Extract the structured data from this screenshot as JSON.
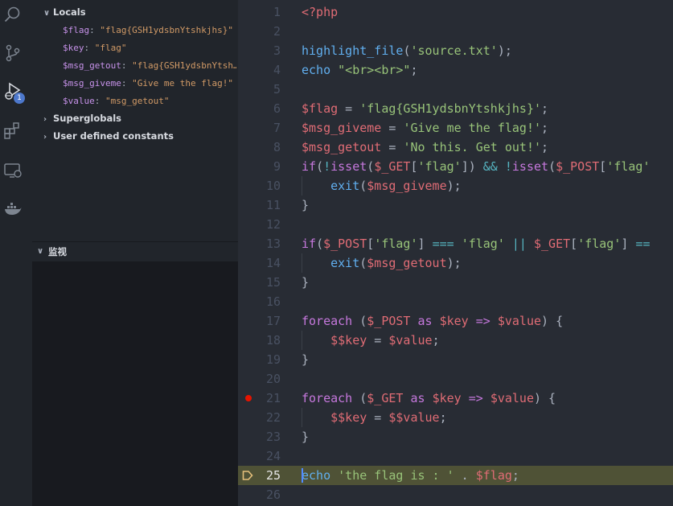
{
  "activity_bar": {
    "icons": [
      "search-icon",
      "source-control-icon",
      "run-debug-icon",
      "extensions-icon",
      "remote-explorer-icon",
      "docker-icon"
    ],
    "debug_badge": "1"
  },
  "variables": {
    "locals_label": "Locals",
    "locals": [
      {
        "name": "$flag",
        "value": "\"flag{GSH1ydsbnYtshkjhs}\""
      },
      {
        "name": "$key",
        "value": "\"flag\""
      },
      {
        "name": "$msg_getout",
        "value": "\"flag{GSH1ydsbnYtsh…"
      },
      {
        "name": "$msg_giveme",
        "value": "\"Give me the flag!\""
      },
      {
        "name": "$value",
        "value": "\"msg_getout\""
      }
    ],
    "superglobals_label": "Superglobals",
    "constants_label": "User defined constants"
  },
  "watch": {
    "label": "监视"
  },
  "editor": {
    "current_line": 25,
    "breakpoint_line": 21,
    "line_numbers": [
      "1",
      "2",
      "3",
      "4",
      "5",
      "6",
      "7",
      "8",
      "9",
      "10",
      "11",
      "12",
      "13",
      "14",
      "15",
      "16",
      "17",
      "18",
      "19",
      "20",
      "21",
      "22",
      "23",
      "24",
      "25",
      "26"
    ],
    "lines": [
      [
        {
          "t": "<?php",
          "c": "tag"
        }
      ],
      [],
      [
        {
          "t": "highlight_file",
          "c": "fn"
        },
        {
          "t": "(",
          "c": "pl"
        },
        {
          "t": "'source.txt'",
          "c": "str"
        },
        {
          "t": ");",
          "c": "pl"
        }
      ],
      [
        {
          "t": "echo",
          "c": "fn"
        },
        {
          "t": " ",
          "c": "pl"
        },
        {
          "t": "\"<br><br>\"",
          "c": "str"
        },
        {
          "t": ";",
          "c": "pl"
        }
      ],
      [],
      [
        {
          "t": "$flag",
          "c": "var"
        },
        {
          "t": " = ",
          "c": "pl"
        },
        {
          "t": "'flag{GSH1ydsbnYtshkjhs}'",
          "c": "str"
        },
        {
          "t": ";",
          "c": "pl"
        }
      ],
      [
        {
          "t": "$msg_giveme",
          "c": "var"
        },
        {
          "t": " = ",
          "c": "pl"
        },
        {
          "t": "'Give me the flag!'",
          "c": "str"
        },
        {
          "t": ";",
          "c": "pl"
        }
      ],
      [
        {
          "t": "$msg_getout",
          "c": "var"
        },
        {
          "t": " = ",
          "c": "pl"
        },
        {
          "t": "'No this. Get out!'",
          "c": "str"
        },
        {
          "t": ";",
          "c": "pl"
        }
      ],
      [
        {
          "t": "if",
          "c": "kw"
        },
        {
          "t": "(",
          "c": "pl"
        },
        {
          "t": "!",
          "c": "op"
        },
        {
          "t": "isset",
          "c": "kw"
        },
        {
          "t": "(",
          "c": "pl"
        },
        {
          "t": "$_GET",
          "c": "var"
        },
        {
          "t": "[",
          "c": "pl"
        },
        {
          "t": "'flag'",
          "c": "str"
        },
        {
          "t": "]) ",
          "c": "pl"
        },
        {
          "t": "&&",
          "c": "op"
        },
        {
          "t": " ",
          "c": "pl"
        },
        {
          "t": "!",
          "c": "op"
        },
        {
          "t": "isset",
          "c": "kw"
        },
        {
          "t": "(",
          "c": "pl"
        },
        {
          "t": "$_POST",
          "c": "var"
        },
        {
          "t": "[",
          "c": "pl"
        },
        {
          "t": "'flag'",
          "c": "str"
        }
      ],
      [
        {
          "t": "    ",
          "c": "pl"
        },
        {
          "t": "exit",
          "c": "fn"
        },
        {
          "t": "(",
          "c": "pl"
        },
        {
          "t": "$msg_giveme",
          "c": "var"
        },
        {
          "t": ");",
          "c": "pl"
        }
      ],
      [
        {
          "t": "}",
          "c": "pl"
        }
      ],
      [],
      [
        {
          "t": "if",
          "c": "kw"
        },
        {
          "t": "(",
          "c": "pl"
        },
        {
          "t": "$_POST",
          "c": "var"
        },
        {
          "t": "[",
          "c": "pl"
        },
        {
          "t": "'flag'",
          "c": "str"
        },
        {
          "t": "] ",
          "c": "pl"
        },
        {
          "t": "===",
          "c": "op"
        },
        {
          "t": " ",
          "c": "pl"
        },
        {
          "t": "'flag'",
          "c": "str"
        },
        {
          "t": " ",
          "c": "pl"
        },
        {
          "t": "||",
          "c": "op"
        },
        {
          "t": " ",
          "c": "pl"
        },
        {
          "t": "$_GET",
          "c": "var"
        },
        {
          "t": "[",
          "c": "pl"
        },
        {
          "t": "'flag'",
          "c": "str"
        },
        {
          "t": "] ",
          "c": "pl"
        },
        {
          "t": "==",
          "c": "op"
        }
      ],
      [
        {
          "t": "    ",
          "c": "pl"
        },
        {
          "t": "exit",
          "c": "fn"
        },
        {
          "t": "(",
          "c": "pl"
        },
        {
          "t": "$msg_getout",
          "c": "var"
        },
        {
          "t": ");",
          "c": "pl"
        }
      ],
      [
        {
          "t": "}",
          "c": "pl"
        }
      ],
      [],
      [
        {
          "t": "foreach",
          "c": "kw"
        },
        {
          "t": " (",
          "c": "pl"
        },
        {
          "t": "$_POST",
          "c": "var"
        },
        {
          "t": " ",
          "c": "pl"
        },
        {
          "t": "as",
          "c": "kw"
        },
        {
          "t": " ",
          "c": "pl"
        },
        {
          "t": "$key",
          "c": "var"
        },
        {
          "t": " ",
          "c": "pl"
        },
        {
          "t": "=>",
          "c": "kw"
        },
        {
          "t": " ",
          "c": "pl"
        },
        {
          "t": "$value",
          "c": "var"
        },
        {
          "t": ") {",
          "c": "pl"
        }
      ],
      [
        {
          "t": "    ",
          "c": "pl"
        },
        {
          "t": "$$key",
          "c": "var"
        },
        {
          "t": " = ",
          "c": "pl"
        },
        {
          "t": "$value",
          "c": "var"
        },
        {
          "t": ";",
          "c": "pl"
        }
      ],
      [
        {
          "t": "}",
          "c": "pl"
        }
      ],
      [],
      [
        {
          "t": "foreach",
          "c": "kw"
        },
        {
          "t": " (",
          "c": "pl"
        },
        {
          "t": "$_GET",
          "c": "var"
        },
        {
          "t": " ",
          "c": "pl"
        },
        {
          "t": "as",
          "c": "kw"
        },
        {
          "t": " ",
          "c": "pl"
        },
        {
          "t": "$key",
          "c": "var"
        },
        {
          "t": " ",
          "c": "pl"
        },
        {
          "t": "=>",
          "c": "kw"
        },
        {
          "t": " ",
          "c": "pl"
        },
        {
          "t": "$value",
          "c": "var"
        },
        {
          "t": ") {",
          "c": "pl"
        }
      ],
      [
        {
          "t": "    ",
          "c": "pl"
        },
        {
          "t": "$$key",
          "c": "var"
        },
        {
          "t": " = ",
          "c": "pl"
        },
        {
          "t": "$$value",
          "c": "var"
        },
        {
          "t": ";",
          "c": "pl"
        }
      ],
      [
        {
          "t": "}",
          "c": "pl"
        }
      ],
      [],
      [
        {
          "t": "echo",
          "c": "fn"
        },
        {
          "t": " ",
          "c": "pl"
        },
        {
          "t": "'the flag is : '",
          "c": "str"
        },
        {
          "t": " . ",
          "c": "pl"
        },
        {
          "t": "$flag",
          "c": "var"
        },
        {
          "t": ";",
          "c": "pl"
        }
      ],
      []
    ]
  },
  "colors": {
    "current_line_highlight": "#4f5236",
    "breakpoint": "#e51400",
    "debug_pointer": "#e5c07b"
  }
}
